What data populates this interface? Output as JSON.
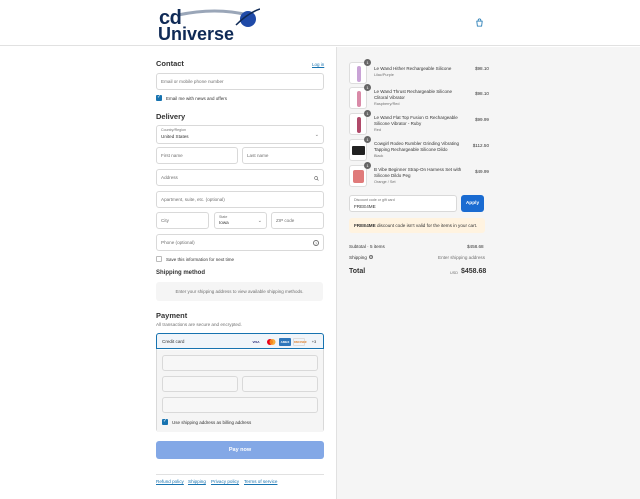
{
  "header": {
    "logo": {
      "top": "cd",
      "bottom": "Universe"
    },
    "cart_icon": "shopping-bag-icon"
  },
  "contact": {
    "title": "Contact",
    "login_link": "Log in",
    "email_placeholder": "Email or mobile phone number",
    "news_checkbox_label": "Email me with news and offers",
    "news_checked": true
  },
  "delivery": {
    "title": "Delivery",
    "country_label": "Country/Region",
    "country_value": "United States",
    "first_name_placeholder": "First name",
    "last_name_placeholder": "Last name",
    "address_placeholder": "Address",
    "apartment_placeholder": "Apartment, suite, etc. (optional)",
    "city_placeholder": "City",
    "state_label": "State",
    "state_value": "Iowa",
    "zip_placeholder": "ZIP code",
    "phone_placeholder": "Phone (optional)",
    "save_info_label": "Save this information for next time",
    "save_info_checked": false
  },
  "shipping_method": {
    "title": "Shipping method",
    "notice": "Enter your shipping address to view available shipping methods."
  },
  "payment": {
    "title": "Payment",
    "subtitle": "All transactions are secure and encrypted.",
    "method_label": "Credit card",
    "card_brands": [
      "VISA",
      "MC",
      "AMEX",
      "DISCOVER"
    ],
    "more_cards": "+3",
    "billing_checkbox_label": "Use shipping address as billing address",
    "billing_checked": true,
    "pay_button": "Pay now"
  },
  "footer": {
    "links": [
      "Refund policy",
      "Shipping",
      "Privacy policy",
      "Terms of service"
    ]
  },
  "order": {
    "items": [
      {
        "qty": "1",
        "name": "Le Wand Hither Rechargeable Silicone",
        "variant": "Lilac/Purple",
        "price": "$98.10",
        "thumb_color": "#c9a3d6"
      },
      {
        "qty": "1",
        "name": "Le Wand Thrust Rechargeable Silicone Clitoral Vibrator",
        "variant": "Raspberry/Red",
        "price": "$98.10",
        "thumb_color": "#d98aa8"
      },
      {
        "qty": "1",
        "name": "Le Wand Flat Top Fusion G Rechargeable Silicone Vibrator - Ruby",
        "variant": "Red",
        "price": "$99.99",
        "thumb_color": "#b04a6a"
      },
      {
        "qty": "1",
        "name": "Cowgirl Rodeo Rumbler Grinding Vibrating Tapping Rechargeable Silicone Dildo",
        "variant": "Black",
        "price": "$112.50",
        "thumb_color": "#222222"
      },
      {
        "qty": "1",
        "name": "B Vibe Beginner Strap-On Harness Set with Silicone Dildo Peg",
        "variant": "Orange / Set",
        "price": "$49.99",
        "thumb_color": "#e07a7a"
      }
    ],
    "discount_label": "Discount code or gift card",
    "discount_value": "FREE4ME",
    "apply_button": "Apply",
    "discount_warning_code": "FREE4ME",
    "discount_warning_text": " discount code isn't valid for the items in your cart.",
    "subtotal_label": "Subtotal · 5 items",
    "subtotal_value": "$458.68",
    "shipping_label": "Shipping",
    "shipping_value": "Enter shipping address",
    "total_label": "Total",
    "currency": "USD",
    "total_value": "$458.68"
  },
  "colors": {
    "accent": "#1773b0",
    "brand": "#0f2a56",
    "pay_button": "#83a8e6",
    "apply_button": "#1a6bd1",
    "warning_bg": "#fff3e0"
  }
}
